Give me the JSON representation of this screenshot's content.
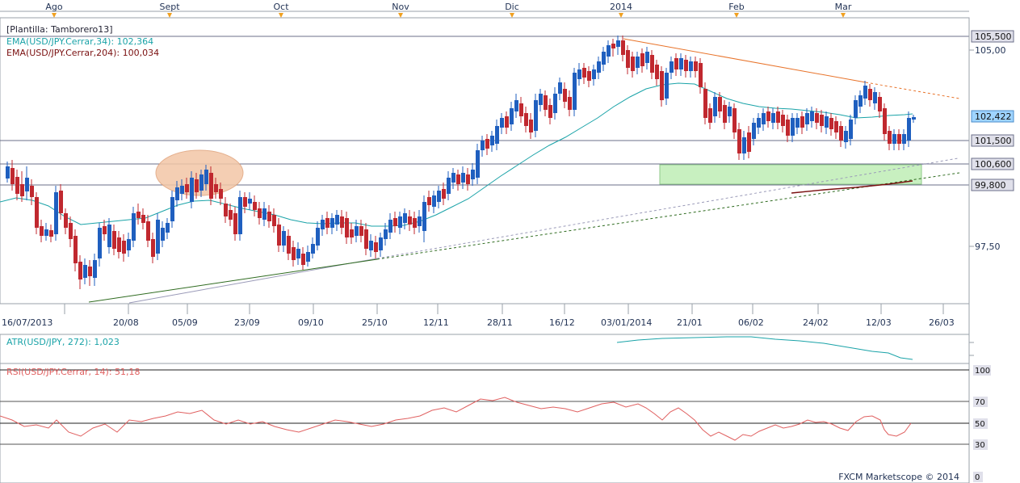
{
  "top_months": [
    "Ago",
    "Sept",
    "Oct",
    "Nov",
    "Dic",
    "2014",
    "Feb",
    "Mar"
  ],
  "main": {
    "template_label": "[Plantilla: Tamborero13]",
    "ema34_label": "EMA(USD/JPY.Cerrar,34): 102,364",
    "ema204_label": "EMA(USD/JPY.Cerrar,204): 100,034",
    "price_labels": [
      "105,00",
      "97,50"
    ],
    "highlighted_prices": [
      "105,500",
      "102,422",
      "101,500",
      "100,600",
      "99,800"
    ],
    "date_labels": [
      "16/07/2013",
      "20/08",
      "05/09",
      "23/09",
      "09/10",
      "25/10",
      "12/11",
      "28/11",
      "16/12",
      "03/01/2014",
      "21/01",
      "06/02",
      "24/02",
      "12/03",
      "26/03"
    ]
  },
  "atr": {
    "label": "ATR(USD/JPY, 272): 1,023"
  },
  "rsi": {
    "label": "RSI(USD/JPY.Cerrar, 14): 51,18",
    "levels": [
      "100",
      "70",
      "50",
      "30",
      "0"
    ]
  },
  "footer": {
    "credit": "FXCM Marketscope © 2014"
  },
  "colors": {
    "bull": "#1f5fbf",
    "bear": "#c0282f",
    "ema34": "#1aa3a8",
    "ema204": "#7a1010",
    "resistance": "#e8732a",
    "support": "#2e6b1f",
    "zone": "#c8f0c0",
    "ellipse": "#f3c6a6"
  },
  "chart_data": [
    {
      "type": "candlestick",
      "title": "USD/JPY",
      "ylim": [
        95.9,
        106.0
      ],
      "key_levels": [
        105.5,
        102.422,
        101.5,
        100.6,
        99.8
      ],
      "last_close": 102.422,
      "approx_closes": [
        100.2,
        99.6,
        98.4,
        96.3,
        98.2,
        97.8,
        98.7,
        99.2,
        99.9,
        98.5,
        99.5,
        100.5,
        99.2,
        98.1,
        98.9,
        98.0,
        97.2,
        98.6,
        97.5,
        98.2,
        97.6,
        100.2,
        101.7,
        102.3,
        103.4,
        103.8,
        105.1,
        104.3,
        103.2,
        103.0,
        104.6,
        102.8,
        102.0,
        101.0,
        101.9,
        102.5,
        101.9,
        102.4,
        101.7,
        102.1,
        103.3,
        102.3,
        101.2,
        102.4
      ]
    },
    {
      "type": "line",
      "title": "ATR(USD/JPY, 272)",
      "last_value": 1.023
    },
    {
      "type": "line",
      "title": "RSI(USD/JPY.Cerrar, 14)",
      "ylim": [
        0,
        100
      ],
      "levels": [
        30,
        50,
        70
      ],
      "last_value": 51.18
    }
  ]
}
